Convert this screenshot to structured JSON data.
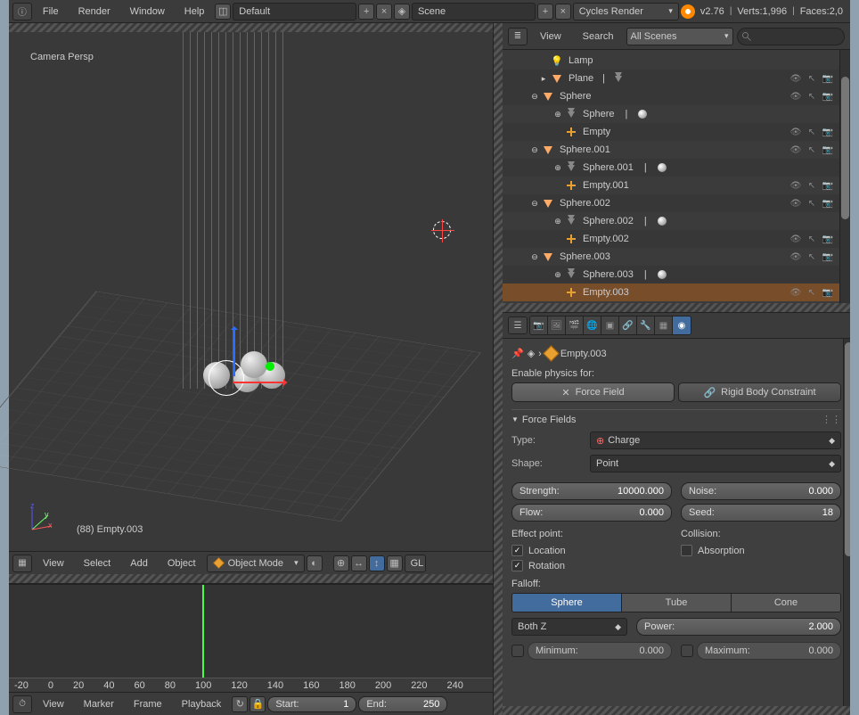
{
  "topmenu": {
    "items": [
      "File",
      "Render",
      "Window",
      "Help"
    ],
    "layout": "Default",
    "scene": "Scene",
    "engine": "Cycles Render",
    "version": "v2.76",
    "verts": "Verts:1,996",
    "faces": "Faces:2,0"
  },
  "view3d": {
    "label": "Camera Persp",
    "object_label": "(88) Empty.003",
    "bar": {
      "menus": [
        "View",
        "Select",
        "Add",
        "Object"
      ],
      "mode": "Object Mode"
    }
  },
  "timeline": {
    "ruler": [
      "-20",
      "0",
      "20",
      "40",
      "60",
      "80",
      "100",
      "120",
      "140",
      "160",
      "180",
      "200",
      "220",
      "240"
    ],
    "bar": {
      "menus": [
        "View",
        "Marker",
        "Frame",
        "Playback"
      ],
      "start_label": "Start:",
      "start": "1",
      "end_label": "End:",
      "end": "250"
    }
  },
  "outliner": {
    "title": "View",
    "search_label": "Search",
    "filter": "All Scenes",
    "rows": [
      {
        "ind": 40,
        "exp": "",
        "ico": "lamp",
        "label": "Lamp",
        "tail": false,
        "sel": false
      },
      {
        "ind": 40,
        "exp": "▾",
        "ico": "tri",
        "label": "Plane",
        "extra": "mesh",
        "tail": true,
        "sel": false
      },
      {
        "ind": 30,
        "exp": "⊖",
        "ico": "",
        "label": "",
        "tail": false,
        "sel": false,
        "grp_open": true,
        "spacer": true,
        "hidden": true
      },
      {
        "ind": 30,
        "exp": "⊖",
        "ico": "tri",
        "label": "Sphere",
        "tail": true,
        "sel": false,
        "grp": true
      },
      {
        "ind": 56,
        "exp": "⊕",
        "ico": "mesh",
        "label": "Sphere",
        "extra": "mat",
        "tail": false,
        "sel": false
      },
      {
        "ind": 56,
        "exp": "",
        "ico": "empty",
        "label": "Empty",
        "tail": true,
        "sel": false
      },
      {
        "ind": 30,
        "exp": "⊖",
        "ico": "tri",
        "label": "Sphere.001",
        "tail": true,
        "sel": false,
        "grp": true
      },
      {
        "ind": 56,
        "exp": "⊕",
        "ico": "mesh",
        "label": "Sphere.001",
        "extra": "mat",
        "tail": false,
        "sel": false
      },
      {
        "ind": 56,
        "exp": "",
        "ico": "empty",
        "label": "Empty.001",
        "tail": true,
        "sel": false
      },
      {
        "ind": 30,
        "exp": "⊖",
        "ico": "tri",
        "label": "Sphere.002",
        "tail": true,
        "sel": false,
        "grp": true
      },
      {
        "ind": 56,
        "exp": "⊕",
        "ico": "mesh",
        "label": "Sphere.002",
        "extra": "mat",
        "tail": false,
        "sel": false
      },
      {
        "ind": 56,
        "exp": "",
        "ico": "empty",
        "label": "Empty.002",
        "tail": true,
        "sel": false
      },
      {
        "ind": 30,
        "exp": "⊖",
        "ico": "tri",
        "label": "Sphere.003",
        "tail": true,
        "sel": false,
        "grp": true
      },
      {
        "ind": 56,
        "exp": "⊕",
        "ico": "mesh",
        "label": "Sphere.003",
        "extra": "mat",
        "tail": false,
        "sel": false
      },
      {
        "ind": 56,
        "exp": "",
        "ico": "empty",
        "label": "Empty.003",
        "tail": true,
        "sel": true
      }
    ]
  },
  "props": {
    "breadcrumb": "Empty.003",
    "enable_label": "Enable physics for:",
    "btn_forcefield": "Force Field",
    "btn_rigidbody": "Rigid Body Constraint",
    "panel": "Force Fields",
    "type_label": "Type:",
    "type": "Charge",
    "shape_label": "Shape:",
    "shape": "Point",
    "strength_label": "Strength:",
    "strength": "10000.000",
    "noise_label": "Noise:",
    "noise": "0.000",
    "flow_label": "Flow:",
    "flow": "0.000",
    "seed_label": "Seed:",
    "seed": "18",
    "effect_label": "Effect point:",
    "collision_label": "Collision:",
    "location": "Location",
    "rotation": "Rotation",
    "absorption": "Absorption",
    "falloff_label": "Falloff:",
    "falloff_tabs": [
      "Sphere",
      "Tube",
      "Cone"
    ],
    "bothz": "Both Z",
    "power_label": "Power:",
    "power": "2.000",
    "min_label": "Minimum:",
    "min": "0.000",
    "max_label": "Maximum:",
    "max": "0.000"
  }
}
